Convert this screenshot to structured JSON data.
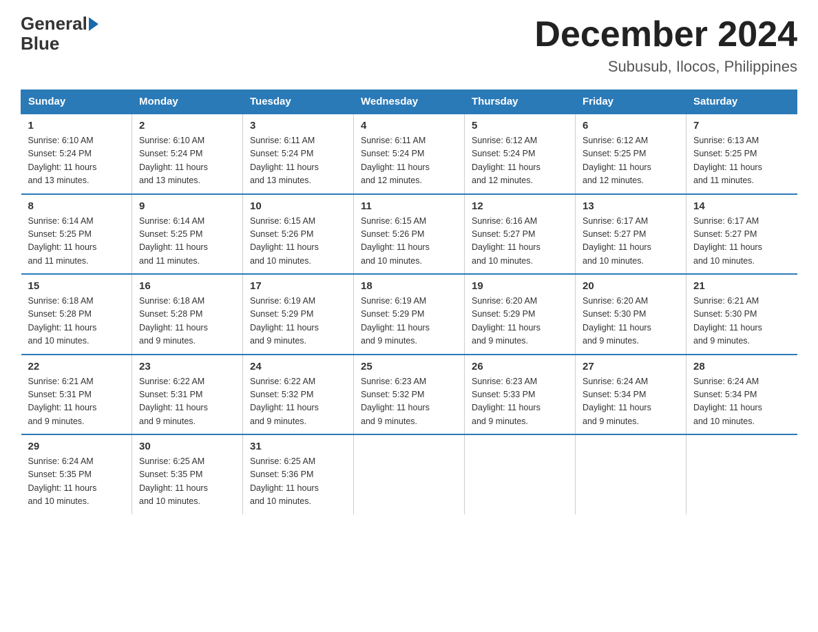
{
  "logo": {
    "text_general": "General",
    "text_blue": "Blue",
    "arrow_color": "#1a6aab"
  },
  "header": {
    "month_title": "December 2024",
    "subtitle": "Subusub, Ilocos, Philippines"
  },
  "days_of_week": [
    "Sunday",
    "Monday",
    "Tuesday",
    "Wednesday",
    "Thursday",
    "Friday",
    "Saturday"
  ],
  "weeks": [
    [
      {
        "day": "1",
        "info": "Sunrise: 6:10 AM\nSunset: 5:24 PM\nDaylight: 11 hours\nand 13 minutes."
      },
      {
        "day": "2",
        "info": "Sunrise: 6:10 AM\nSunset: 5:24 PM\nDaylight: 11 hours\nand 13 minutes."
      },
      {
        "day": "3",
        "info": "Sunrise: 6:11 AM\nSunset: 5:24 PM\nDaylight: 11 hours\nand 13 minutes."
      },
      {
        "day": "4",
        "info": "Sunrise: 6:11 AM\nSunset: 5:24 PM\nDaylight: 11 hours\nand 12 minutes."
      },
      {
        "day": "5",
        "info": "Sunrise: 6:12 AM\nSunset: 5:24 PM\nDaylight: 11 hours\nand 12 minutes."
      },
      {
        "day": "6",
        "info": "Sunrise: 6:12 AM\nSunset: 5:25 PM\nDaylight: 11 hours\nand 12 minutes."
      },
      {
        "day": "7",
        "info": "Sunrise: 6:13 AM\nSunset: 5:25 PM\nDaylight: 11 hours\nand 11 minutes."
      }
    ],
    [
      {
        "day": "8",
        "info": "Sunrise: 6:14 AM\nSunset: 5:25 PM\nDaylight: 11 hours\nand 11 minutes."
      },
      {
        "day": "9",
        "info": "Sunrise: 6:14 AM\nSunset: 5:25 PM\nDaylight: 11 hours\nand 11 minutes."
      },
      {
        "day": "10",
        "info": "Sunrise: 6:15 AM\nSunset: 5:26 PM\nDaylight: 11 hours\nand 10 minutes."
      },
      {
        "day": "11",
        "info": "Sunrise: 6:15 AM\nSunset: 5:26 PM\nDaylight: 11 hours\nand 10 minutes."
      },
      {
        "day": "12",
        "info": "Sunrise: 6:16 AM\nSunset: 5:27 PM\nDaylight: 11 hours\nand 10 minutes."
      },
      {
        "day": "13",
        "info": "Sunrise: 6:17 AM\nSunset: 5:27 PM\nDaylight: 11 hours\nand 10 minutes."
      },
      {
        "day": "14",
        "info": "Sunrise: 6:17 AM\nSunset: 5:27 PM\nDaylight: 11 hours\nand 10 minutes."
      }
    ],
    [
      {
        "day": "15",
        "info": "Sunrise: 6:18 AM\nSunset: 5:28 PM\nDaylight: 11 hours\nand 10 minutes."
      },
      {
        "day": "16",
        "info": "Sunrise: 6:18 AM\nSunset: 5:28 PM\nDaylight: 11 hours\nand 9 minutes."
      },
      {
        "day": "17",
        "info": "Sunrise: 6:19 AM\nSunset: 5:29 PM\nDaylight: 11 hours\nand 9 minutes."
      },
      {
        "day": "18",
        "info": "Sunrise: 6:19 AM\nSunset: 5:29 PM\nDaylight: 11 hours\nand 9 minutes."
      },
      {
        "day": "19",
        "info": "Sunrise: 6:20 AM\nSunset: 5:29 PM\nDaylight: 11 hours\nand 9 minutes."
      },
      {
        "day": "20",
        "info": "Sunrise: 6:20 AM\nSunset: 5:30 PM\nDaylight: 11 hours\nand 9 minutes."
      },
      {
        "day": "21",
        "info": "Sunrise: 6:21 AM\nSunset: 5:30 PM\nDaylight: 11 hours\nand 9 minutes."
      }
    ],
    [
      {
        "day": "22",
        "info": "Sunrise: 6:21 AM\nSunset: 5:31 PM\nDaylight: 11 hours\nand 9 minutes."
      },
      {
        "day": "23",
        "info": "Sunrise: 6:22 AM\nSunset: 5:31 PM\nDaylight: 11 hours\nand 9 minutes."
      },
      {
        "day": "24",
        "info": "Sunrise: 6:22 AM\nSunset: 5:32 PM\nDaylight: 11 hours\nand 9 minutes."
      },
      {
        "day": "25",
        "info": "Sunrise: 6:23 AM\nSunset: 5:32 PM\nDaylight: 11 hours\nand 9 minutes."
      },
      {
        "day": "26",
        "info": "Sunrise: 6:23 AM\nSunset: 5:33 PM\nDaylight: 11 hours\nand 9 minutes."
      },
      {
        "day": "27",
        "info": "Sunrise: 6:24 AM\nSunset: 5:34 PM\nDaylight: 11 hours\nand 9 minutes."
      },
      {
        "day": "28",
        "info": "Sunrise: 6:24 AM\nSunset: 5:34 PM\nDaylight: 11 hours\nand 10 minutes."
      }
    ],
    [
      {
        "day": "29",
        "info": "Sunrise: 6:24 AM\nSunset: 5:35 PM\nDaylight: 11 hours\nand 10 minutes."
      },
      {
        "day": "30",
        "info": "Sunrise: 6:25 AM\nSunset: 5:35 PM\nDaylight: 11 hours\nand 10 minutes."
      },
      {
        "day": "31",
        "info": "Sunrise: 6:25 AM\nSunset: 5:36 PM\nDaylight: 11 hours\nand 10 minutes."
      },
      {
        "day": "",
        "info": ""
      },
      {
        "day": "",
        "info": ""
      },
      {
        "day": "",
        "info": ""
      },
      {
        "day": "",
        "info": ""
      }
    ]
  ]
}
